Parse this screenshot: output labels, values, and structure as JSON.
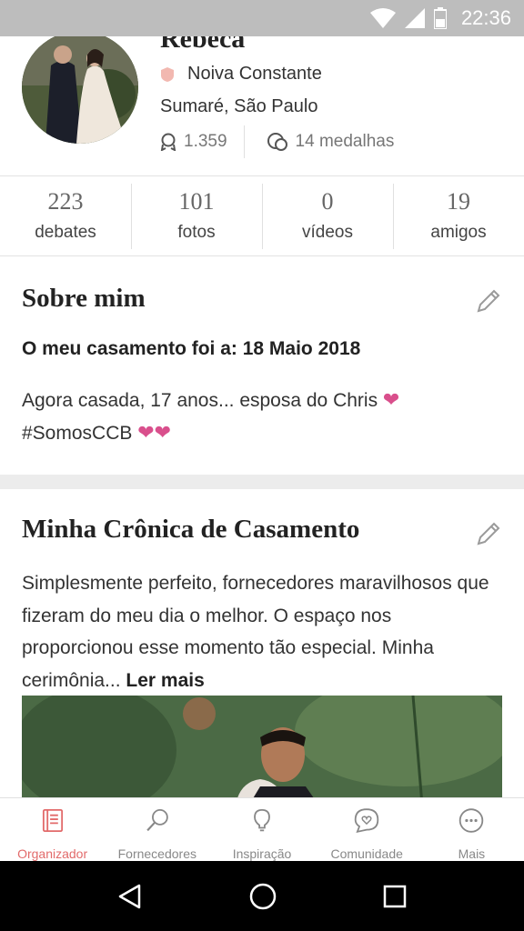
{
  "status_bar": {
    "time": "22:36",
    "colors": {
      "background": "#bdbdbd",
      "icons": "#ffffff"
    }
  },
  "profile": {
    "name": "Rebeca",
    "role": "Noiva Constante",
    "location": "Sumaré, São Paulo",
    "points": "1.359",
    "medals": "14 medalhas"
  },
  "counts": [
    {
      "value": "223",
      "label": "debates"
    },
    {
      "value": "101",
      "label": "fotos"
    },
    {
      "value": "0",
      "label": "vídeos"
    },
    {
      "value": "19",
      "label": "amigos"
    }
  ],
  "about": {
    "title": "Sobre mim",
    "wedding_date": "O meu casamento foi a: 18 Maio 2018",
    "line1": "Agora casada, 17 anos... esposa do Chris",
    "line2": "#SomosCCB",
    "heart_color": "#d94f8c"
  },
  "chronicle": {
    "title": "Minha Crônica de Casamento",
    "text": "Simplesmente perfeito, fornecedores maravilhosos que fizeram do meu dia o melhor. O espaço nos proporcionou esse momento tão especial. Minha cerimônia...",
    "read_more": "Ler mais"
  },
  "bottom_nav": {
    "active_color": "#e26a6a",
    "items": [
      {
        "label": "Organizador",
        "icon": "planner-book-icon"
      },
      {
        "label": "Fornecedores",
        "icon": "search-icon"
      },
      {
        "label": "Inspiração",
        "icon": "lightbulb-icon"
      },
      {
        "label": "Comunidade",
        "icon": "chat-heart-icon"
      },
      {
        "label": "Mais",
        "icon": "more-dots-icon"
      }
    ]
  }
}
